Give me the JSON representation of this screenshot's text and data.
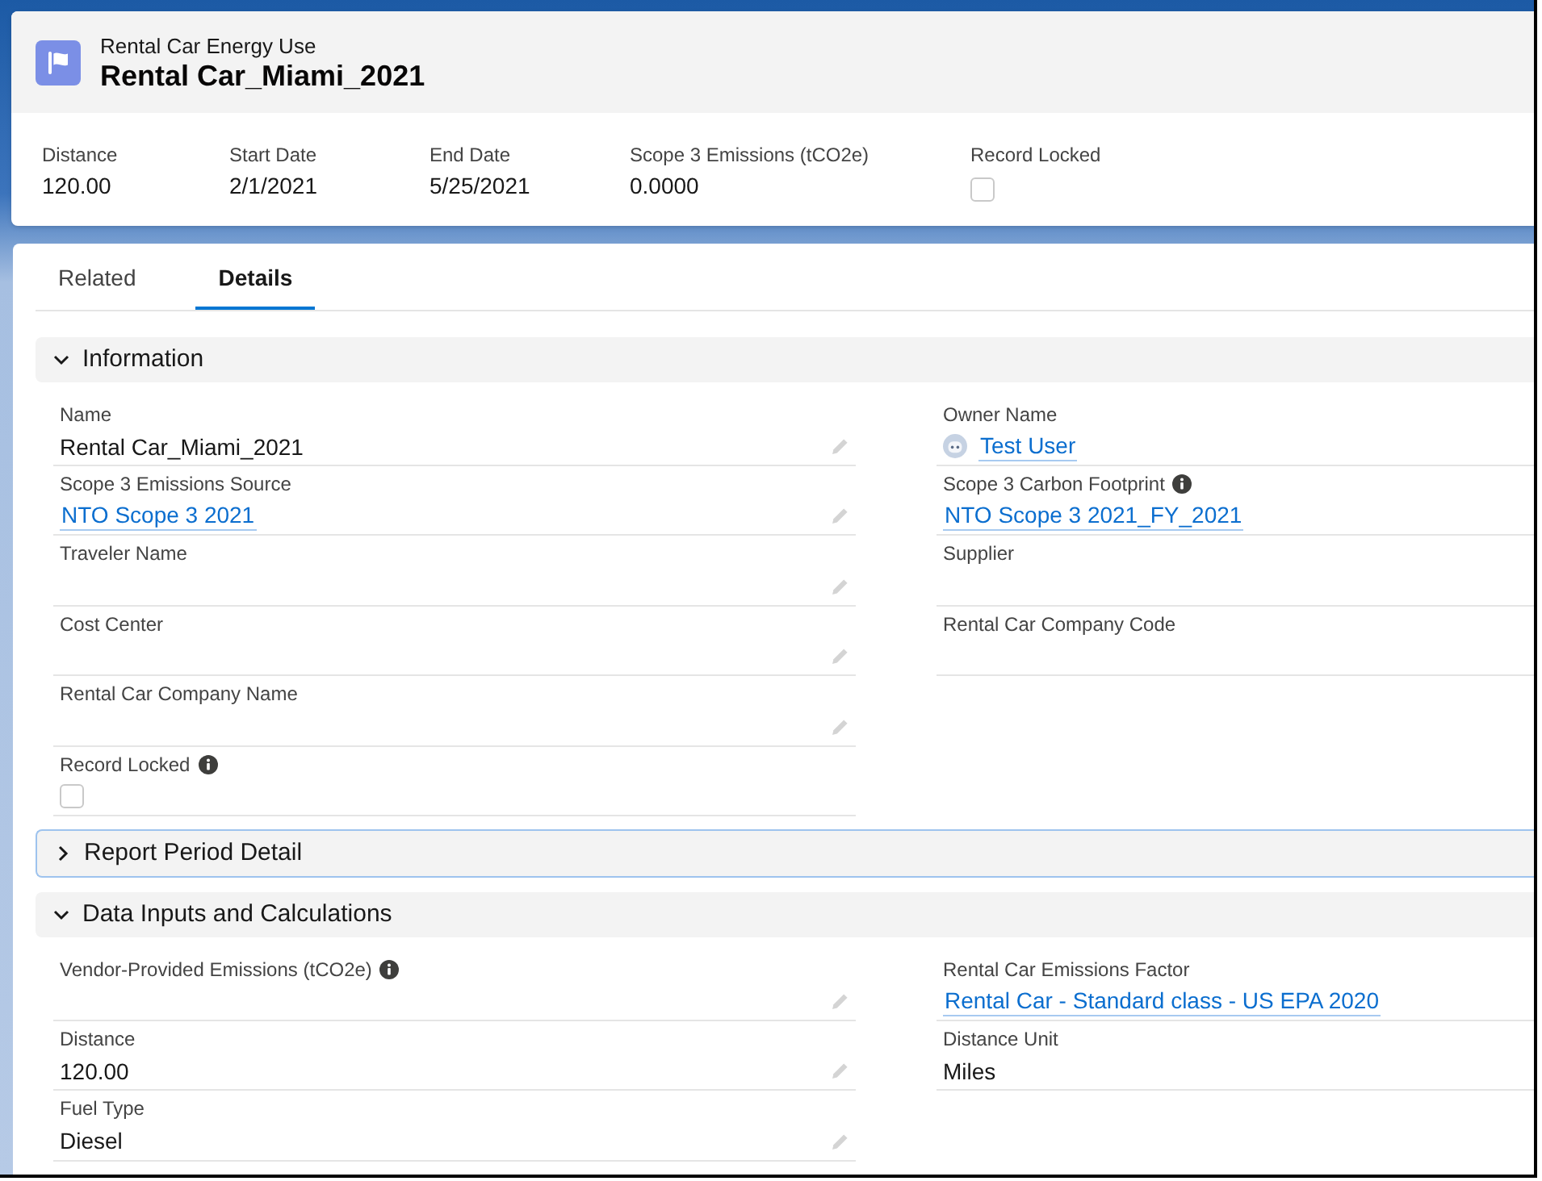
{
  "record_header": {
    "object_type": "Rental Car Energy Use",
    "title": "Rental Car_Miami_2021",
    "highlights": [
      {
        "label": "Distance",
        "kind": "text",
        "value": "120.00"
      },
      {
        "label": "Start Date",
        "kind": "text",
        "value": "2/1/2021"
      },
      {
        "label": "End Date",
        "kind": "text",
        "value": "5/25/2021"
      },
      {
        "label": "Scope 3 Emissions (tCO2e)",
        "kind": "text",
        "value": "0.0000"
      },
      {
        "label": "Record Locked",
        "kind": "checkbox",
        "checked": false
      }
    ]
  },
  "tabs": [
    {
      "label": "Related",
      "selected": false
    },
    {
      "label": "Details",
      "selected": true
    }
  ],
  "sections": [
    {
      "title": "Information",
      "expanded": true,
      "focused": false,
      "columns": [
        [
          {
            "label": "Name",
            "kind": "text",
            "value": "Rental Car_Miami_2021",
            "info": false,
            "editable": true
          },
          {
            "label": "Scope 3 Emissions Source",
            "kind": "link",
            "value": "NTO Scope 3 2021",
            "info": false,
            "editable": true
          },
          {
            "label": "Traveler Name",
            "kind": "text",
            "info": false,
            "editable": true
          },
          {
            "label": "Cost Center",
            "kind": "text",
            "info": false,
            "editable": true
          },
          {
            "label": "Rental Car Company Name",
            "kind": "text",
            "info": false,
            "editable": true
          },
          {
            "label": "Record Locked",
            "kind": "checkbox",
            "checked": false,
            "info": true,
            "editable": false
          }
        ],
        [
          {
            "label": "Owner Name",
            "kind": "user",
            "value": "Test User",
            "info": false,
            "editable": false
          },
          {
            "label": "Scope 3 Carbon Footprint",
            "kind": "link",
            "value": "NTO Scope 3 2021_FY_2021",
            "info": true,
            "editable": false
          },
          {
            "label": "Supplier",
            "kind": "text",
            "info": false,
            "editable": false
          },
          {
            "label": "Rental Car Company Code",
            "kind": "text",
            "info": false,
            "editable": false
          }
        ]
      ]
    },
    {
      "title": "Report Period Detail",
      "expanded": false,
      "focused": true
    },
    {
      "title": "Data Inputs and Calculations",
      "expanded": true,
      "focused": false,
      "columns": [
        [
          {
            "label": "Vendor-Provided Emissions (tCO2e)",
            "kind": "text",
            "info": true,
            "editable": true
          },
          {
            "label": "Distance",
            "kind": "text",
            "value": "120.00",
            "info": false,
            "editable": true
          },
          {
            "label": "Fuel Type",
            "kind": "text",
            "value": "Diesel",
            "info": false,
            "editable": true
          }
        ],
        [
          {
            "label": "Rental Car Emissions Factor",
            "kind": "link",
            "value": "Rental Car - Standard class - US EPA 2020",
            "info": false,
            "editable": false
          },
          {
            "label": "Distance Unit",
            "kind": "text",
            "value": "Miles",
            "info": false,
            "editable": false
          }
        ]
      ]
    }
  ]
}
